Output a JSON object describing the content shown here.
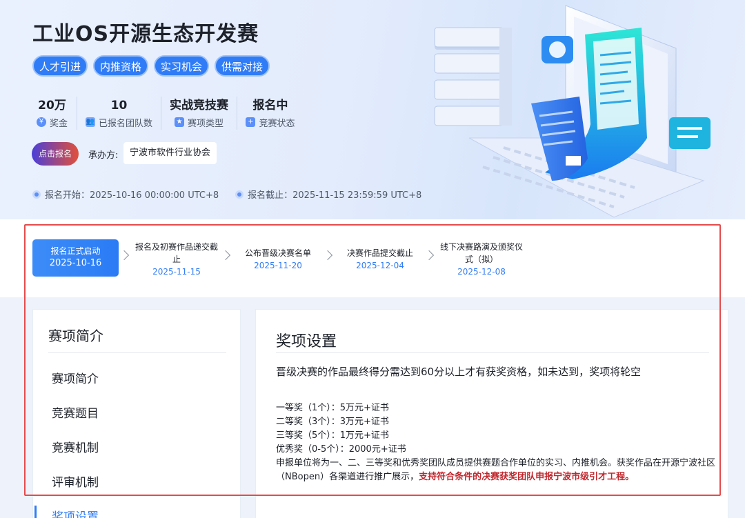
{
  "hero": {
    "title": "工业OS开源生态开发赛",
    "tags": [
      "人才引进",
      "内推资格",
      "实习机会",
      "供需对接"
    ],
    "stats": [
      {
        "value": "20万",
        "label": "奖金",
        "icon": "money-bag-icon"
      },
      {
        "value": "10",
        "label": "已报名团队数",
        "icon": "team-icon"
      },
      {
        "value": "实战竞技赛",
        "label": "赛项类型",
        "icon": "bookmark-icon"
      },
      {
        "value": "报名中",
        "label": "竞赛状态",
        "icon": "status-icon"
      }
    ],
    "signup_label": "点击报名",
    "host_label": "承办方:",
    "host_value": "宁波市软件行业协会",
    "start_date": "报名开始：2025-10-16 00:00:00 UTC+8",
    "end_date": "报名截止：2025-11-15 23:59:59 UTC+8"
  },
  "timeline": [
    {
      "title": "报名正式启动",
      "date": "2025-10-16"
    },
    {
      "title": "报名及初赛作品递交截止",
      "date": "2025-11-15"
    },
    {
      "title": "公布晋级决赛名单",
      "date": "2025-11-20"
    },
    {
      "title": "决赛作品提交截止",
      "date": "2025-12-04"
    },
    {
      "title": "线下决赛路演及颁奖仪式（拟）",
      "date": "2025-12-08"
    }
  ],
  "sidebar": {
    "title": "赛项简介",
    "items": [
      "赛项简介",
      "竞赛题目",
      "竞赛机制",
      "评审机制",
      "奖项设置"
    ],
    "active_index": 4
  },
  "content": {
    "title": "奖项设置",
    "intro": "晋级决赛的作品最终得分需达到60分以上才有获奖资格，如未达到，奖项将轮空",
    "prizes": [
      "一等奖（1个）：5万元+证书",
      "二等奖（3个）：3万元+证书",
      "三等奖（5个）：1万元+证书",
      "优秀奖（0-5个）：2000元+证书"
    ],
    "note": "申报单位将为一、二、三等奖和优秀奖团队成员提供赛题合作单位的实习、内推机会。获奖作品在开源宁波社区（NBopen）各渠道进行推广展示，",
    "note_highlight": "支持符合条件的决赛获奖团队申报宁波市级引才工程。"
  },
  "colors": {
    "accent": "#2f7cf6",
    "highlight_box": "#e54b4b",
    "highlight_text": "#c1272d"
  }
}
